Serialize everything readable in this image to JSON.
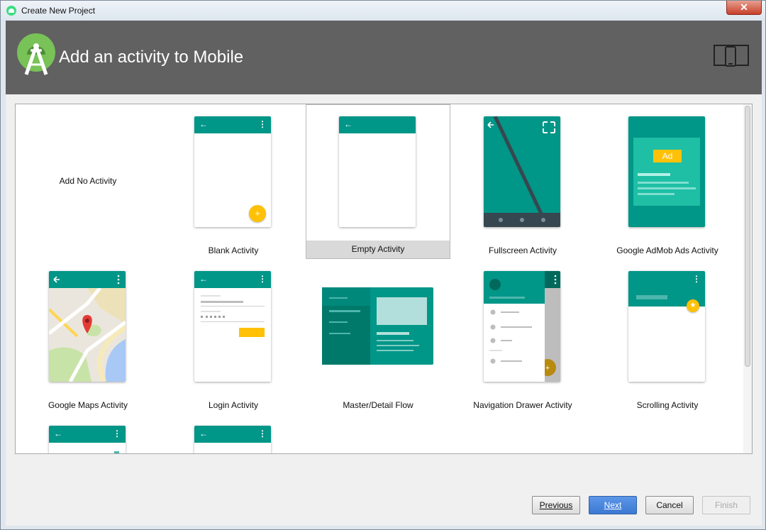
{
  "window": {
    "title": "Create New Project",
    "close_label": "✕"
  },
  "header": {
    "title": "Add an activity to Mobile"
  },
  "templates": [
    {
      "label": "Add No Activity"
    },
    {
      "label": "Blank Activity"
    },
    {
      "label": "Empty Activity",
      "selected": true
    },
    {
      "label": "Fullscreen Activity"
    },
    {
      "label": "Google AdMob Ads Activity",
      "ad_badge": "Ad"
    },
    {
      "label": "Google Maps Activity"
    },
    {
      "label": "Login Activity"
    },
    {
      "label": "Master/Detail Flow"
    },
    {
      "label": "Navigation Drawer Activity"
    },
    {
      "label": "Scrolling Activity"
    }
  ],
  "icons": {
    "fab_plus": "+",
    "star": "★",
    "back_arrow": "←",
    "menu_dots": "⋮"
  },
  "buttons": {
    "previous": "Previous",
    "next": "Next",
    "cancel": "Cancel",
    "finish": "Finish"
  },
  "colors": {
    "teal": "#009688",
    "dark_teal": "#00796b",
    "amber": "#ffc107",
    "header": "#616161",
    "primary_button": "#4a86dd"
  }
}
